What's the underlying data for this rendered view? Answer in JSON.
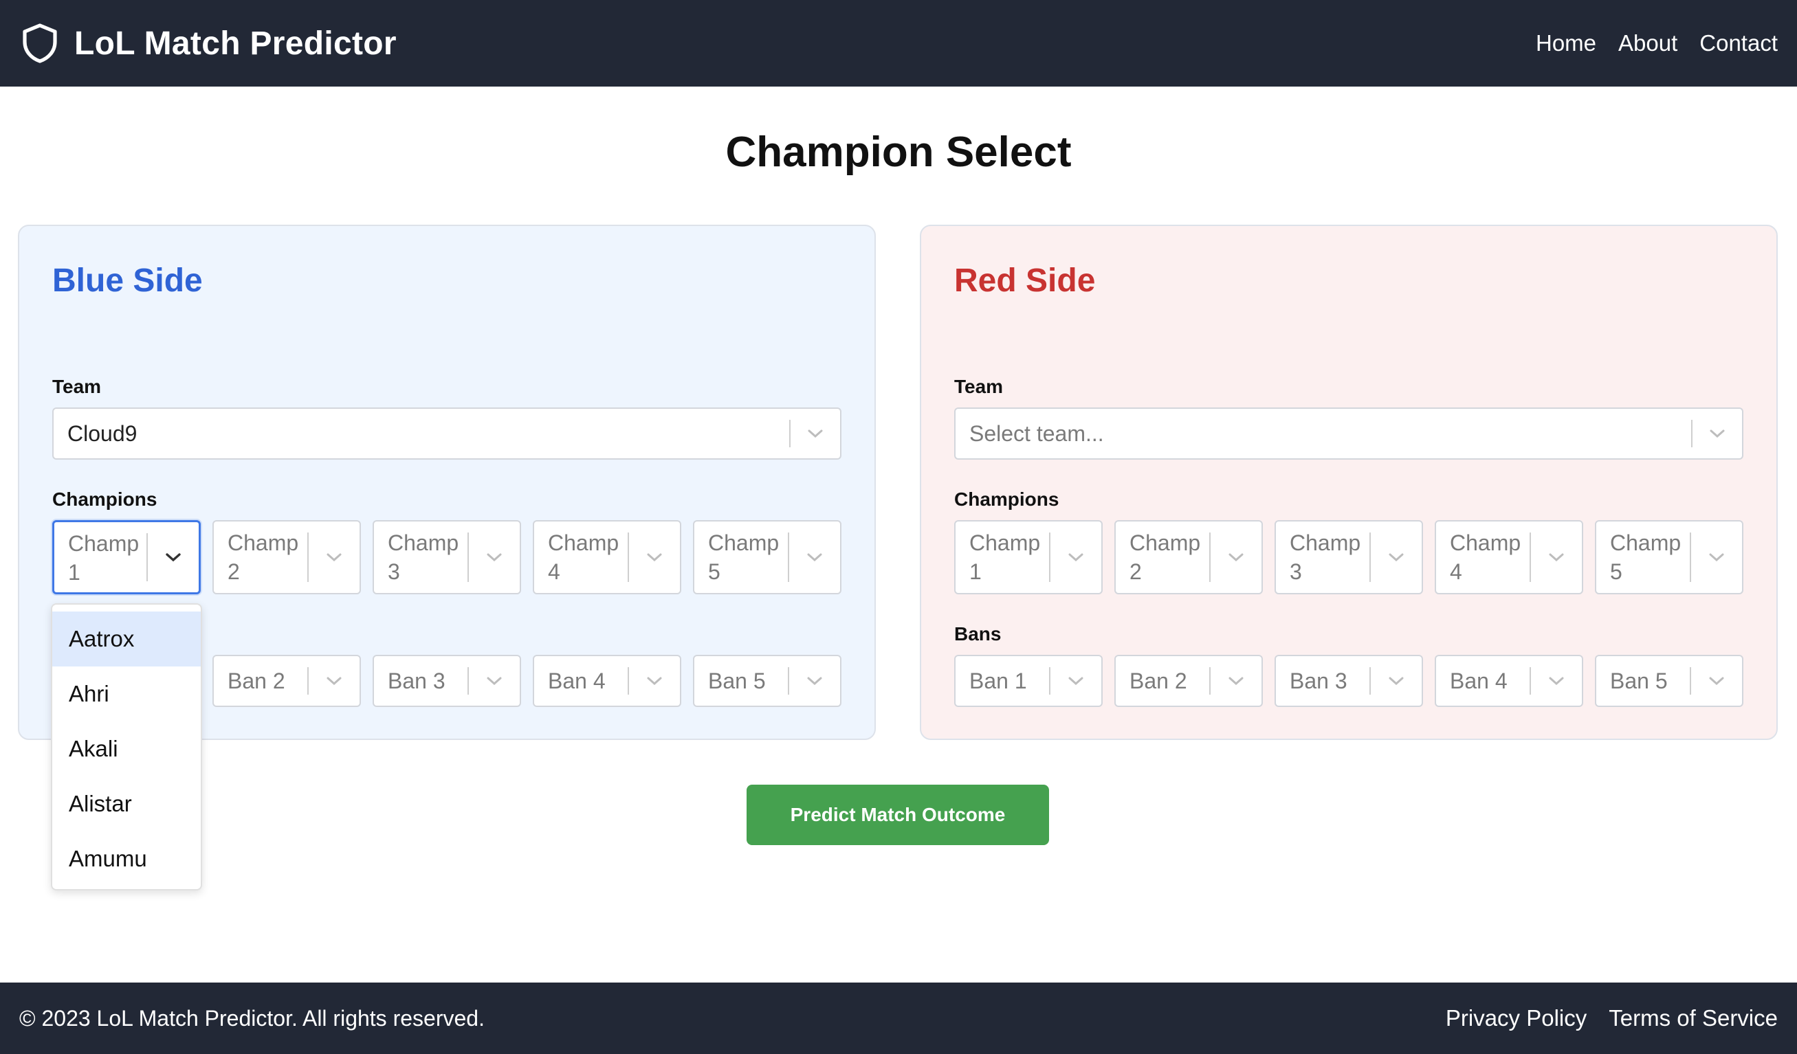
{
  "nav": {
    "brand": "LoL Match Predictor",
    "links": [
      "Home",
      "About",
      "Contact"
    ]
  },
  "page_title": "Champion Select",
  "blue": {
    "title": "Blue Side",
    "team_label": "Team",
    "team_value": "Cloud9",
    "champions_label": "Champions",
    "champions": [
      "Champ 1",
      "Champ 2",
      "Champ 3",
      "Champ 4",
      "Champ 5"
    ],
    "bans": [
      "Ban 2",
      "Ban 3",
      "Ban 4",
      "Ban 5"
    ]
  },
  "red": {
    "title": "Red Side",
    "team_label": "Team",
    "team_placeholder": "Select team...",
    "champions_label": "Champions",
    "champions": [
      "Champ 1",
      "Champ 2",
      "Champ 3",
      "Champ 4",
      "Champ 5"
    ],
    "bans_label": "Bans",
    "bans": [
      "Ban 1",
      "Ban 2",
      "Ban 3",
      "Ban 4",
      "Ban 5"
    ]
  },
  "dropdown_options": [
    "Aatrox",
    "Ahri",
    "Akali",
    "Alistar",
    "Amumu"
  ],
  "predict_button": "Predict Match Outcome",
  "footer": {
    "copyright": "© 2023 LoL Match Predictor. All rights reserved.",
    "links": [
      "Privacy Policy",
      "Terms of Service"
    ]
  },
  "colors": {
    "navbar": "#222836",
    "blue_accent": "#2f63d5",
    "red_accent": "#c83331",
    "predict_button": "#45a14f"
  }
}
